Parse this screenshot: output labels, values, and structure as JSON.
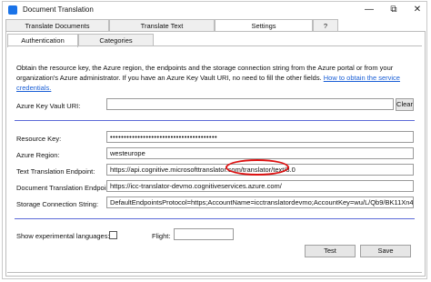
{
  "window": {
    "title": "Document Translation",
    "buttons": {
      "minimize": "—",
      "restore": "⧉",
      "close": "✕"
    }
  },
  "tabs": [
    {
      "label": "Translate Documents"
    },
    {
      "label": "Translate Text"
    },
    {
      "label": "Settings"
    },
    {
      "label": "?"
    }
  ],
  "subtabs": [
    {
      "label": "Authentication"
    },
    {
      "label": "Categories"
    }
  ],
  "description": {
    "text": "Obtain the resource key, the Azure region, the endpoints and the storage connection string from the Azure portal or from your organization's Azure administrator. If you have an Azure Key Vault URI, no need to fill the other fields.",
    "link": "How to obtain the service credentials."
  },
  "key_vault": {
    "label": "Azure Key Vault URI:",
    "value": "",
    "clear_label": "Clear"
  },
  "fields": {
    "resource_key": {
      "label": "Resource Key:",
      "value": "•••••••••••••••••••••••••••••••••••••••"
    },
    "region": {
      "label": "Azure Region:",
      "value": "westeurope"
    },
    "text_endpoint": {
      "label": "Text Translation Endpoint:",
      "value": "https://api.cognitive.microsofttranslator.com/translator/text/3.0"
    },
    "doc_endpoint": {
      "label": "Document Translation Endpoint:",
      "value": "https://icc-translator-devmo.cognitiveservices.azure.com/"
    },
    "storage": {
      "label": "Storage Connection String:",
      "value": "DefaultEndpointsProtocol=https;AccountName=icctranslatordevmo;AccountKey=wu/L/Qb9/BK11Xn4vFNT8ur47jl"
    }
  },
  "options": {
    "experimental_label": "Show experimental languages:",
    "experimental_checked": false,
    "flight_label": "Flight:",
    "flight_value": ""
  },
  "actions": {
    "test_label": "Test",
    "save_label": "Save"
  },
  "colors": {
    "link": "#1a5fd6",
    "separator": "#5c6bd8",
    "annotation": "#dd1111"
  }
}
